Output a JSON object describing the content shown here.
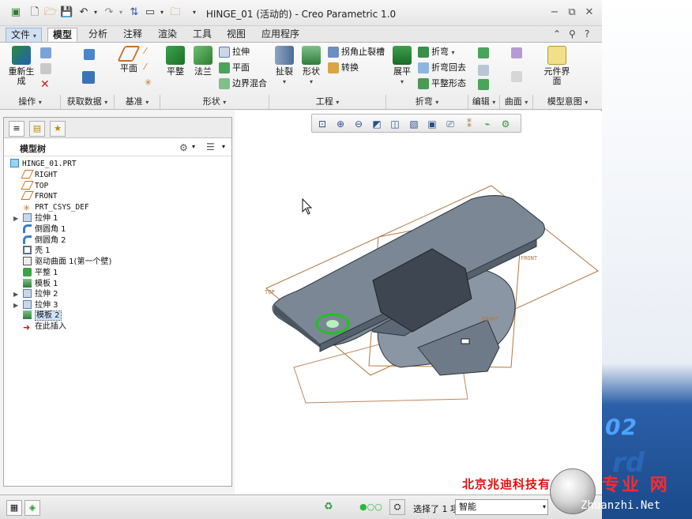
{
  "titlebar": {
    "title": "HINGE_01 (活动的) - Creo Parametric 1.0",
    "min": "−",
    "restore": "⧉",
    "close": "✕"
  },
  "tabs": [
    {
      "label": "文件"
    },
    {
      "label": "模型"
    },
    {
      "label": "分析"
    },
    {
      "label": "注释"
    },
    {
      "label": "渲染"
    },
    {
      "label": "工具"
    },
    {
      "label": "视图"
    },
    {
      "label": "应用程序"
    }
  ],
  "ribbon": {
    "regen": "重新生成",
    "plane": "平面",
    "flat": "平整",
    "flange": "法兰",
    "extrude": "拉伸",
    "flatsmall": "平面",
    "blend": "边界混合",
    "rip": "扯裂",
    "form": "形状",
    "corner": "拐角止裂槽",
    "convert": "转换",
    "unbend": "展平",
    "bend": "折弯",
    "bendback": "折弯回去",
    "flatpattern": "平整形态",
    "component": "元件界面",
    "groups": {
      "ops": "操作",
      "getdata": "获取数据",
      "datum": "基准",
      "shape": "形状",
      "eng": "工程",
      "bendg": "折弯",
      "edit": "编辑",
      "surface": "曲面",
      "intent": "模型意图"
    }
  },
  "tree": {
    "title": "模型树",
    "items": [
      {
        "label": "HINGE_01.PRT"
      },
      {
        "label": "RIGHT"
      },
      {
        "label": "TOP"
      },
      {
        "label": "FRONT"
      },
      {
        "label": "PRT_CSYS_DEF"
      },
      {
        "label": "拉伸 1"
      },
      {
        "label": "倒圆角 1"
      },
      {
        "label": "倒圆角 2"
      },
      {
        "label": "壳 1"
      },
      {
        "label": "驱动曲面 1(第一个壁)"
      },
      {
        "label": "平整 1"
      },
      {
        "label": "模板 1"
      },
      {
        "label": "拉伸 2"
      },
      {
        "label": "拉伸 3"
      },
      {
        "label": "模板 2"
      },
      {
        "label": "在此插入"
      }
    ]
  },
  "viewport": {
    "labels": {
      "top": "TOP",
      "front": "FRONT",
      "right": "RIGHT"
    }
  },
  "status": {
    "selected": "选择了 1 项",
    "filter": "智能"
  },
  "watermark": {
    "company": "北京兆迪科技有",
    "site_cn": "专业 网",
    "site": "Zhuanzhi.Net",
    "bgnum": "02",
    "bgrd": "rd"
  }
}
